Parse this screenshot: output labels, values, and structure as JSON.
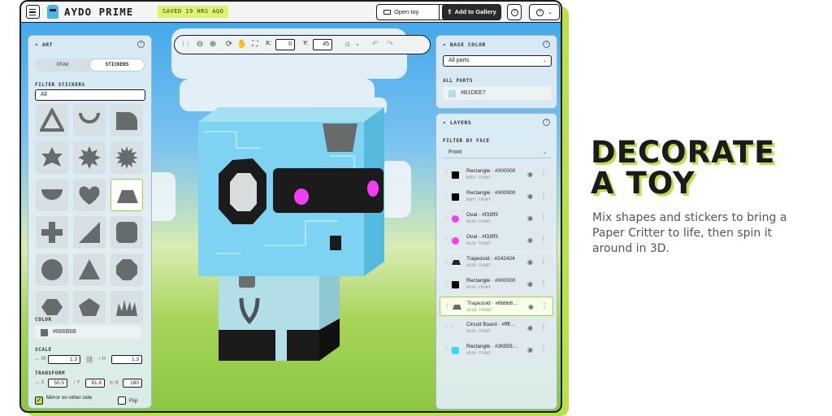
{
  "colors": {
    "accent": "#b9e24a",
    "dark": "#1b1b1b",
    "robot_body": "#b1dee7",
    "screen": "#7fd3f2"
  },
  "app": {
    "title": "AYDO PRIME",
    "saved_status": "SAVED 19 HRS AGO"
  },
  "header": {
    "menu_icon": "hamburger-icon",
    "open_toy_label": "Open toy",
    "add_gallery_label": "Add to Gallery",
    "help_icon": "question-circle-icon",
    "user_icon": "user-circle-icon"
  },
  "toolbar": {
    "x_label": "X:",
    "x_value": "0",
    "y_label": "Y:",
    "y_value": "45"
  },
  "art_panel": {
    "title": "ART",
    "tabs": [
      {
        "label": "DRAW"
      },
      {
        "label": "STICKERS"
      }
    ],
    "filter_label": "FILTER STICKERS",
    "filter_value": "All",
    "stickers": [
      {
        "name": "triangle-outline"
      },
      {
        "name": "arc"
      },
      {
        "name": "quarter-shape"
      },
      {
        "name": "star-6"
      },
      {
        "name": "star-8"
      },
      {
        "name": "star-12"
      },
      {
        "name": "half-circle"
      },
      {
        "name": "heart"
      },
      {
        "name": "trapezoid",
        "selected": true
      },
      {
        "name": "plus"
      },
      {
        "name": "right-triangle"
      },
      {
        "name": "rounded-square"
      },
      {
        "name": "circle"
      },
      {
        "name": "triangle"
      },
      {
        "name": "octagon"
      },
      {
        "name": "hexagon"
      },
      {
        "name": "pentagon"
      },
      {
        "name": "grass"
      }
    ],
    "color_label": "COLOR",
    "color_value": "#686B6B",
    "scale_label": "SCALE",
    "scale_w_label": "↔ W",
    "scale_w": "1.3",
    "scale_h_label": "↕ H",
    "scale_h": "1.3",
    "transform_label": "TRANSFORM",
    "transform_x_label": "↔ X",
    "transform_x": "50.5",
    "transform_y_label": "↕ Y",
    "transform_y": "91.8",
    "transform_r_label": "↻ R",
    "transform_r": "180",
    "mirror_label": "Mirror on other side",
    "mirror_checked": true,
    "flip_label": "Flip",
    "flip_checked": false
  },
  "base_color_panel": {
    "title": "BASE COLOR",
    "select_value": "All parts",
    "section_label": "ALL PARTS",
    "color_value": "#B1DEE7"
  },
  "layers_panel": {
    "title": "LAYERS",
    "filter_label": "FILTER BY FACE",
    "filter_value": "Front",
    "layers": [
      {
        "name": "Rectangle · #000000",
        "face": "BODY FRONT",
        "color": "#000000",
        "shape": "rect"
      },
      {
        "name": "Rectangle · #000000",
        "face": "BODY FRONT",
        "color": "#000000",
        "shape": "rect"
      },
      {
        "name": "Oval · #f33ff3",
        "face": "HEAD FRONT",
        "color": "#f33ff3",
        "shape": "oval"
      },
      {
        "name": "Oval · #f33ff3",
        "face": "HEAD FRONT",
        "color": "#f33ff3",
        "shape": "oval"
      },
      {
        "name": "Trapezoid · #242424",
        "face": "HEAD FRONT",
        "color": "#242424",
        "shape": "trap"
      },
      {
        "name": "Rectangle · #000000",
        "face": "HEAD FRONT",
        "color": "#000000",
        "shape": "rect"
      },
      {
        "name": "Trapezoid · #6b6b6…",
        "face": "HEAD FRONT",
        "color": "#686b6b",
        "shape": "trap",
        "selected": true
      },
      {
        "name": "Circuit Board · #ffff…",
        "face": "HEAD FRONT",
        "color": "#dfe9ee",
        "shape": "none"
      },
      {
        "name": "Rectangle · #3fd5f3…",
        "face": "HEAD FRONT",
        "color": "#3fd5f3",
        "shape": "rect"
      }
    ]
  },
  "promo": {
    "title_line1": "DECORATE",
    "title_line2": "A TOY",
    "body": "Mix shapes and stickers to bring a Paper Critter to life, then spin it around in 3D."
  }
}
